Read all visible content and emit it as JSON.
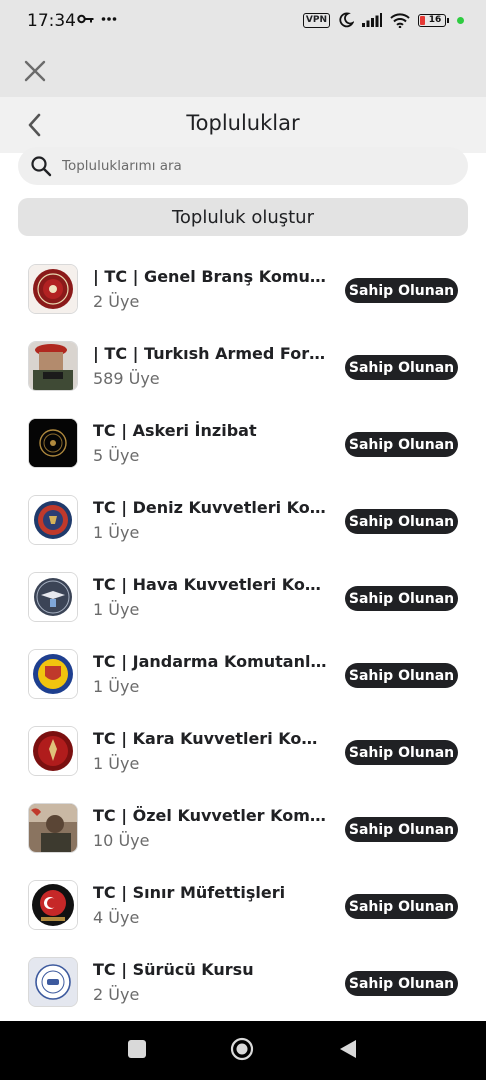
{
  "status_bar": {
    "time": "17:34",
    "vpn": "VPN",
    "battery": "16"
  },
  "header": {
    "title": "Topluluklar"
  },
  "search": {
    "placeholder": "Topluluklarımı ara"
  },
  "create_button": "Topluluk oluştur",
  "communities": [
    {
      "name": "| TC | Genel Branş Komutanlığı",
      "members": "2 Üye",
      "badge": "Sahip Olunan",
      "avatar": "dark-red-emblem"
    },
    {
      "name": "| TC | Turkısh Armed Forces",
      "members": "589 Üye",
      "badge": "Sahip Olunan",
      "avatar": "soldier-red-beret"
    },
    {
      "name": "TC | Askeri İnzibat",
      "members": "5 Üye",
      "badge": "Sahip Olunan",
      "avatar": "black-gold-emblem"
    },
    {
      "name": "TC | Deniz Kuvvetleri Komutanlığı",
      "members": "1 Üye",
      "badge": "Sahip Olunan",
      "avatar": "navy-emblem"
    },
    {
      "name": "TC | Hava Kuvvetleri Komutanlığı",
      "members": "1 Üye",
      "badge": "Sahip Olunan",
      "avatar": "air-force-emblem"
    },
    {
      "name": "TC | Jandarma Komutanlığı",
      "members": "1 Üye",
      "badge": "Sahip Olunan",
      "avatar": "gendarmerie-emblem"
    },
    {
      "name": "TC | Kara Kuvvetleri Komutanlığı",
      "members": "1 Üye",
      "badge": "Sahip Olunan",
      "avatar": "land-forces-emblem"
    },
    {
      "name": "TC | Özel Kuvvetler Komutanlığı",
      "members": "10 Üye",
      "badge": "Sahip Olunan",
      "avatar": "special-forces-image"
    },
    {
      "name": "TC | Sınır Müfettişleri",
      "members": "4 Üye",
      "badge": "Sahip Olunan",
      "avatar": "border-emblem"
    },
    {
      "name": "TC | Sürücü Kursu",
      "members": "2 Üye",
      "badge": "Sahip Olunan",
      "avatar": "driving-course-emblem"
    }
  ]
}
